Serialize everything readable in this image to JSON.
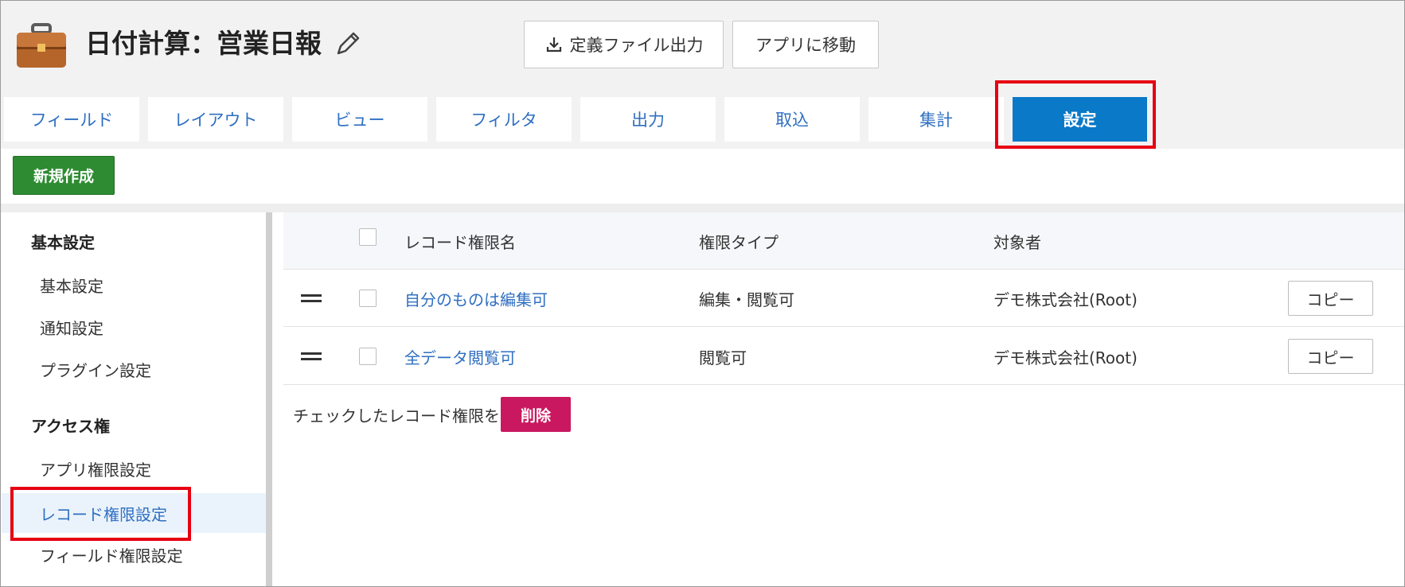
{
  "header": {
    "app_title": "日付計算：営業日報",
    "export_label": "定義ファイル出力",
    "goto_app_label": "アプリに移動"
  },
  "tabs": [
    {
      "label": "フィールド"
    },
    {
      "label": "レイアウト"
    },
    {
      "label": "ビュー"
    },
    {
      "label": "フィルタ"
    },
    {
      "label": "出力"
    },
    {
      "label": "取込"
    },
    {
      "label": "集計"
    },
    {
      "label": "設定",
      "active": true
    }
  ],
  "toolbar": {
    "new_label": "新規作成"
  },
  "sidebar": {
    "sections": [
      {
        "title": "基本設定",
        "items": [
          {
            "label": "基本設定"
          },
          {
            "label": "通知設定"
          },
          {
            "label": "プラグイン設定"
          }
        ]
      },
      {
        "title": "アクセス権",
        "items": [
          {
            "label": "アプリ権限設定"
          },
          {
            "label": "レコード権限設定",
            "active": true
          },
          {
            "label": "フィールド権限設定"
          }
        ]
      }
    ]
  },
  "table": {
    "headers": {
      "name": "レコード権限名",
      "type": "権限タイプ",
      "target": "対象者"
    },
    "rows": [
      {
        "name": "自分のものは編集可",
        "type": "編集・閲覧可",
        "target": "デモ株式会社(Root)",
        "copy": "コピー"
      },
      {
        "name": "全データ閲覧可",
        "type": "閲覧可",
        "target": "デモ株式会社(Root)",
        "copy": "コピー"
      }
    ]
  },
  "bulk": {
    "prompt": "チェックしたレコード権限を",
    "delete_label": "削除"
  },
  "colors": {
    "active_tab": "#0a79c8",
    "link": "#2f6fc1",
    "new_button": "#2e8b32",
    "delete_button": "#c9185f",
    "highlight": "#e60012"
  }
}
